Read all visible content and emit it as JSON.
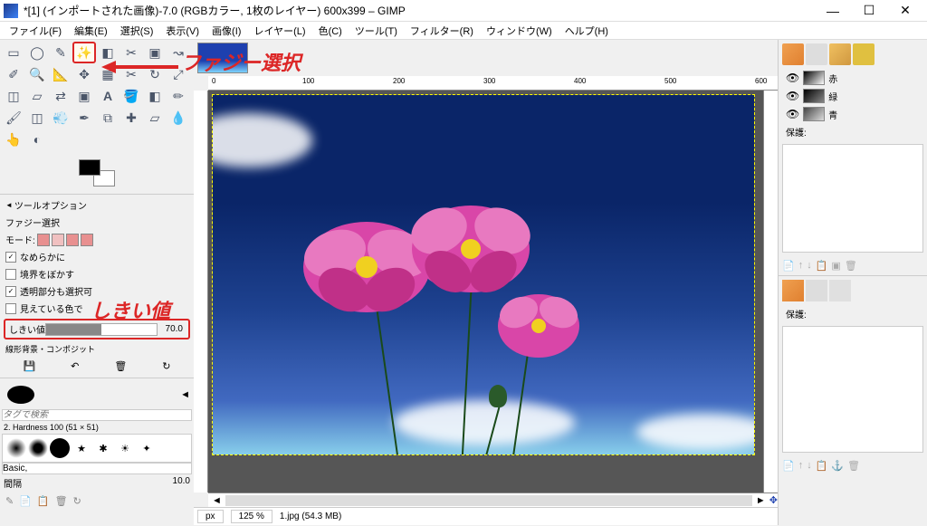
{
  "titlebar": {
    "text": "*[1] (インポートされた画像)-7.0 (RGBカラー, 1枚のレイヤー) 600x399 – GIMP"
  },
  "menu": {
    "file": "ファイル(F)",
    "edit": "編集(E)",
    "select": "選択(S)",
    "view": "表示(V)",
    "image": "画像(I)",
    "layer": "レイヤー(L)",
    "color": "色(C)",
    "tools": "ツール(T)",
    "filters": "フィルター(R)",
    "windows": "ウィンドウ(W)",
    "help": "ヘルプ(H)"
  },
  "tool_options": {
    "header": "ツールオプション",
    "fuzzy_select": "ファジー選択",
    "mode_label": "モード:",
    "smooth": "なめらかに",
    "feather": "境界をぼかす",
    "transparent": "透明部分も選択可",
    "visible_color": "見えている色で",
    "threshold_label": "しきい値",
    "threshold_value": "70.0",
    "composite": "線形背景・コンポジット"
  },
  "brush": {
    "tag_search": "タグで検索",
    "name": "2. Hardness 100 (51 × 51)",
    "basic": "Basic,",
    "spacing_label": "間隔",
    "spacing_value": "10.0"
  },
  "ruler_marks": [
    "0",
    "100",
    "200",
    "300",
    "400",
    "500",
    "600"
  ],
  "status": {
    "unit": "px",
    "zoom": "125 %",
    "file": "1.jpg (54.3 MB)"
  },
  "channels": {
    "r": "赤",
    "g": "緑",
    "b": "青",
    "protect": "保護:"
  },
  "annotations": {
    "fuzzy": "ファジー選択",
    "threshold": "しきい値"
  }
}
